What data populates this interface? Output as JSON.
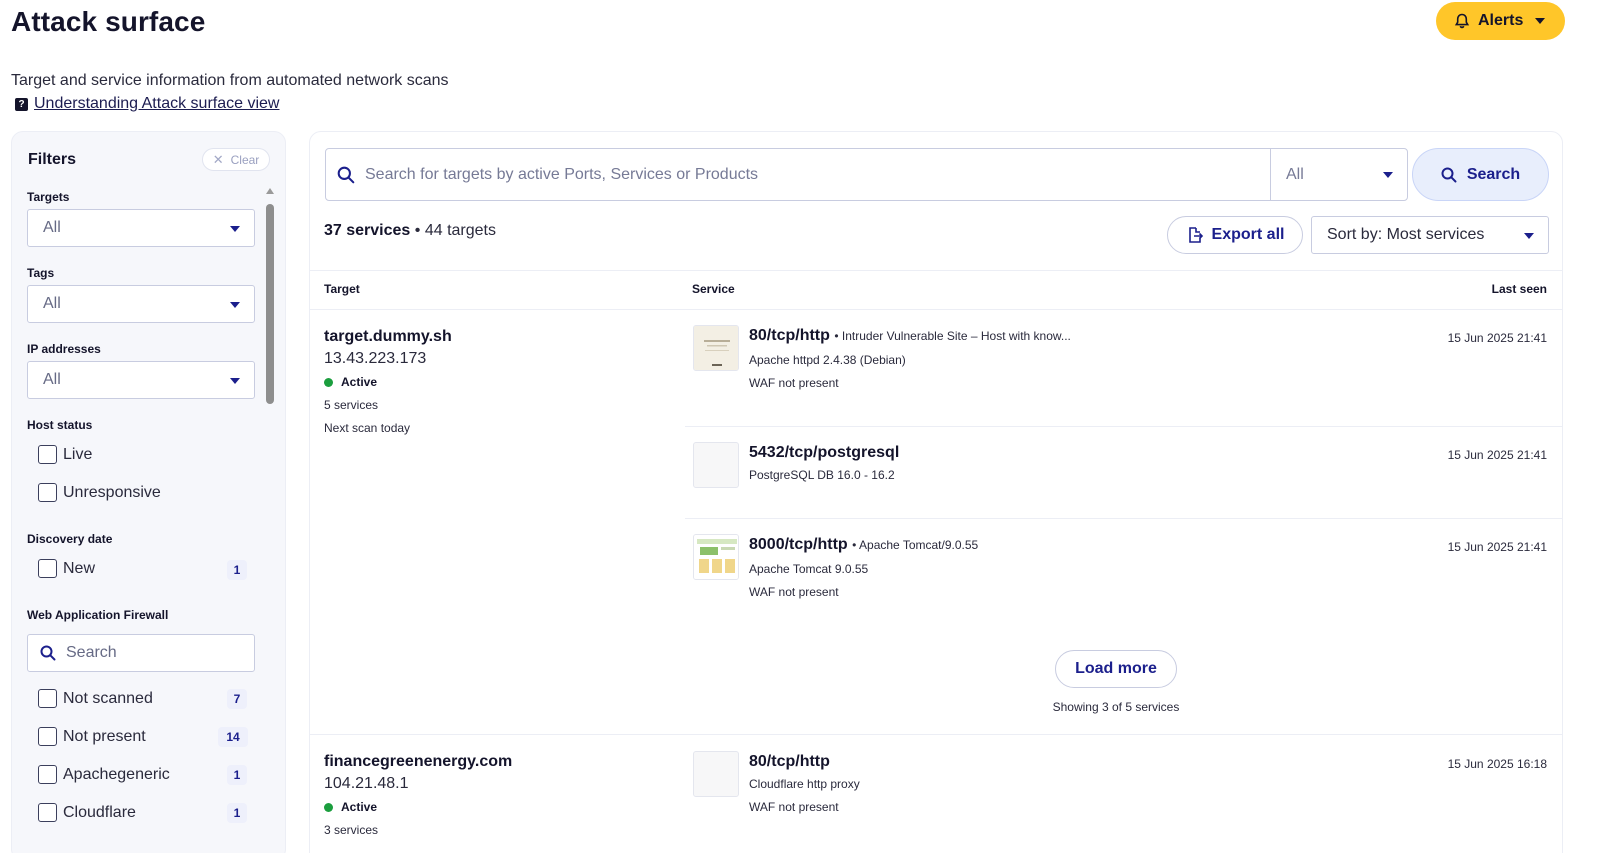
{
  "header": {
    "title": "Attack surface",
    "alerts_label": "Alerts",
    "subtitle": "Target and service information from automated network scans",
    "help_link": "Understanding Attack surface view"
  },
  "filters": {
    "title": "Filters",
    "clear_label": "Clear",
    "targets": {
      "label": "Targets",
      "value": "All"
    },
    "tags": {
      "label": "Tags",
      "value": "All"
    },
    "ip_addresses": {
      "label": "IP addresses",
      "value": "All"
    },
    "host_status": {
      "label": "Host status",
      "options": [
        "Live",
        "Unresponsive"
      ]
    },
    "discovery_date": {
      "label": "Discovery date",
      "options": [
        {
          "label": "New",
          "count": "1"
        }
      ]
    },
    "waf": {
      "label": "Web Application Firewall",
      "search_placeholder": "Search",
      "options": [
        {
          "label": "Not scanned",
          "count": "7"
        },
        {
          "label": "Not present",
          "count": "14"
        },
        {
          "label": "Apachegeneric",
          "count": "1"
        },
        {
          "label": "Cloudflare",
          "count": "1"
        }
      ]
    }
  },
  "main": {
    "search_placeholder": "Search for targets by active Ports, Services or Products",
    "search_scope": "All",
    "search_button": "Search",
    "services_count": "37 services",
    "targets_count": "44 targets",
    "separator": "•",
    "export_label": "Export all",
    "sort_label": "Sort by: Most services",
    "columns": {
      "target": "Target",
      "service": "Service",
      "last_seen": "Last seen"
    },
    "rows": [
      {
        "name": "target.dummy.sh",
        "ip": "13.43.223.173",
        "status": "Active",
        "services": "5 services",
        "next_scan": "Next scan today",
        "items": [
          {
            "port": "80/tcp/http",
            "extra": "• Intruder Vulnerable Site – Host with know...",
            "line1": "Apache httpd 2.4.38 (Debian)",
            "line2": "WAF not present",
            "date": "15 Jun 2025 21:41"
          },
          {
            "port": "5432/tcp/postgresql",
            "extra": "",
            "line1": "PostgreSQL DB 16.0 - 16.2",
            "line2": "",
            "date": "15 Jun 2025 21:41"
          },
          {
            "port": "8000/tcp/http",
            "extra": "• Apache Tomcat/9.0.55",
            "line1": "Apache Tomcat 9.0.55",
            "line2": "WAF not present",
            "date": "15 Jun 2025 21:41"
          }
        ],
        "load_more": "Load more",
        "showing": "Showing 3 of 5 services"
      },
      {
        "name": "financegreenenergy.com",
        "ip": "104.21.48.1",
        "status": "Active",
        "services": "3 services",
        "items": [
          {
            "port": "80/tcp/http",
            "line1": "Cloudflare http proxy",
            "line2": "WAF not present",
            "date": "15 Jun 2025 16:18"
          }
        ]
      }
    ]
  },
  "colors": {
    "accent_yellow": "#ffc629",
    "primary_blue": "#1b1f8c",
    "active_green": "#1b9e3e"
  },
  "icons": [
    "bell-icon",
    "chevron-down-icon",
    "help-icon",
    "close-icon",
    "search-icon",
    "export-icon"
  ]
}
